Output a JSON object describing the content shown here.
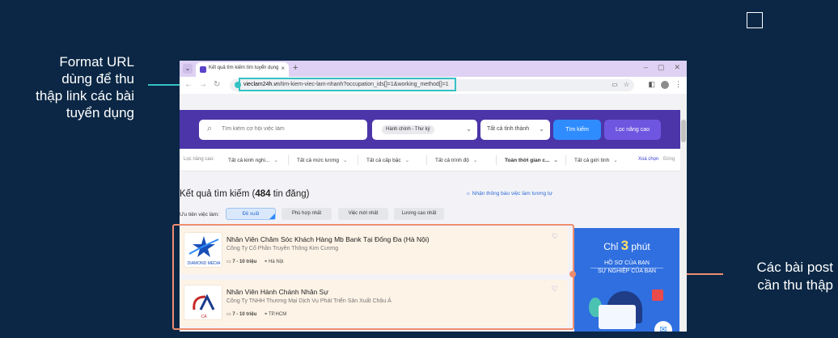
{
  "annotations": {
    "url_note": [
      "Format URL",
      "dùng để thu",
      "thập link các bài",
      "tuyển dụng"
    ],
    "posts_note": [
      "Các bài post",
      "cần thu thập"
    ]
  },
  "browser": {
    "tab_title": "Kết quả tìm kiếm tìm tuyển dụng",
    "url_domain": "vieclam24h.vn",
    "url_path": "/tim-kiem-viec-lam-nhanh?occupation_ids[]=1&working_method[]=1"
  },
  "search": {
    "placeholder": "Tìm kiếm cơ hội việc làm",
    "occupation_chip": "Hành chính - Thư ký",
    "city": "Tất cả tỉnh thành",
    "search_button": "Tìm kiếm",
    "advanced_button": "Lọc nâng cao"
  },
  "filters": {
    "label": "Lọc nâng cao:",
    "items": [
      "Tất cả kinh nghi...",
      "Tất cả mức lương",
      "Tất cả cấp bậc",
      "Tất cả trình độ",
      "Toàn thời gian c...",
      "Tất cả giới tính"
    ],
    "clear": "Xoá chọn",
    "close": "Đóng"
  },
  "results": {
    "title_prefix": "Kết quả tìm kiếm (",
    "count": "484",
    "title_suffix": " tin đăng)",
    "notify": "Nhận thông báo việc làm tương tự"
  },
  "priority": {
    "label": "Ưu tiên việc làm:",
    "options": [
      "Đề xuất",
      "Phù hợp nhất",
      "Việc mới nhất",
      "Lương cao nhất"
    ]
  },
  "jobs": [
    {
      "title": "Nhân Viên Chăm Sóc Khách Hàng Mb Bank Tại Đống Đa (Hà Nội)",
      "company": "Công Ty Cổ Phần Truyền Thông Kim Cương",
      "salary": "7 - 10 triệu",
      "location": "Hà Nội",
      "logo_text": "DIAMOND MEDIA"
    },
    {
      "title": "Nhân Viên Hành Chánh Nhân Sự",
      "company": "Công Ty TNHH Thương Mại Dịch Vụ Phát Triển Sản Xuất Châu Á",
      "salary": "7 - 10 triệu",
      "location": "TP.HCM",
      "logo_text": "CÁ"
    }
  ],
  "ad": {
    "pre": "Chỉ ",
    "big": "3",
    "post": " phút",
    "line1": "HỒ SƠ CỦA BẠN",
    "line2": "SỰ NGHIỆP CỦA BẠN"
  },
  "colors": {
    "background": "#0b2745",
    "url_highlight": "#35c2c4",
    "posts_highlight": "#ef8d6e",
    "search_band": "#4b35a8",
    "search_button": "#2f8cff",
    "advanced_button": "#6e56e0"
  }
}
